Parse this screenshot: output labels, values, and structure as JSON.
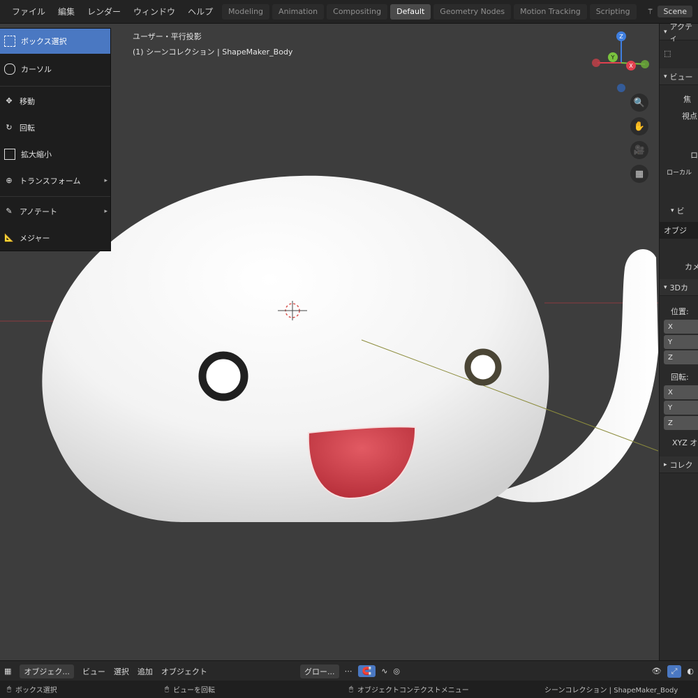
{
  "menu": [
    "ファイル",
    "編集",
    "レンダー",
    "ウィンドウ",
    "ヘルプ"
  ],
  "workspace_tabs": [
    {
      "label": "Modeling",
      "active": false
    },
    {
      "label": "Animation",
      "active": false
    },
    {
      "label": "Compositing",
      "active": false
    },
    {
      "label": "Default",
      "active": true
    },
    {
      "label": "Geometry Nodes",
      "active": false
    },
    {
      "label": "Motion Tracking",
      "active": false
    },
    {
      "label": "Scripting",
      "active": false
    }
  ],
  "scene_name": "Scene",
  "viewport": {
    "line1": "ユーザー・平行投影",
    "line2": "(1) シーンコレクション | ShapeMaker_Body"
  },
  "tool_menu": [
    {
      "label": "ボックス選択",
      "active": true,
      "icon": "box-select-icon"
    },
    {
      "label": "カーソル",
      "active": false,
      "icon": "cursor-icon"
    },
    {
      "label": "移動",
      "active": false,
      "icon": "move-icon"
    },
    {
      "label": "回転",
      "active": false,
      "icon": "rotate-icon"
    },
    {
      "label": "拡大縮小",
      "active": false,
      "icon": "scale-icon"
    },
    {
      "label": "トランスフォーム",
      "active": false,
      "icon": "transform-icon"
    },
    {
      "label": "アノテート",
      "active": false,
      "icon": "annotate-icon"
    },
    {
      "label": "メジャー",
      "active": false,
      "icon": "measure-icon"
    }
  ],
  "gizmo_axes": {
    "x": "X",
    "y": "Y",
    "z": "Z"
  },
  "sidebar": {
    "header1": "アクティ",
    "header2": "ビュー",
    "row_a": "焦",
    "row_b": "視点",
    "row_c": "ロ",
    "row_d": "ローカル",
    "header3": "ビ",
    "row_e": "オブジ",
    "row_f": "カメ",
    "header4": "3Dカ",
    "loc_label": "位置:",
    "x": "X",
    "y": "Y",
    "z": "Z",
    "rot_label": "回転:",
    "rx": "X",
    "ry": "Y",
    "rz": "Z",
    "mode": "XYZ オ",
    "header5": "コレク"
  },
  "bottom_toolbar": {
    "mode": "オブジェク...",
    "view": "ビュー",
    "select": "選択",
    "add": "追加",
    "object": "オブジェクト",
    "transform_orient": "グロー...",
    "snap": "∿"
  },
  "status_bar": {
    "left": "ボックス選択",
    "middle_left": "ビューを回転",
    "middle": "オブジェクトコンテクストメニュー",
    "right": "シーンコレクション | ShapeMaker_Body"
  },
  "colors": {
    "accent_blue": "#4a78c2",
    "mouth_red": "#d8454e",
    "axis_x_red": "#e0414f",
    "axis_y_green": "#7ac33e",
    "axis_z_blue": "#3f7fe0"
  }
}
